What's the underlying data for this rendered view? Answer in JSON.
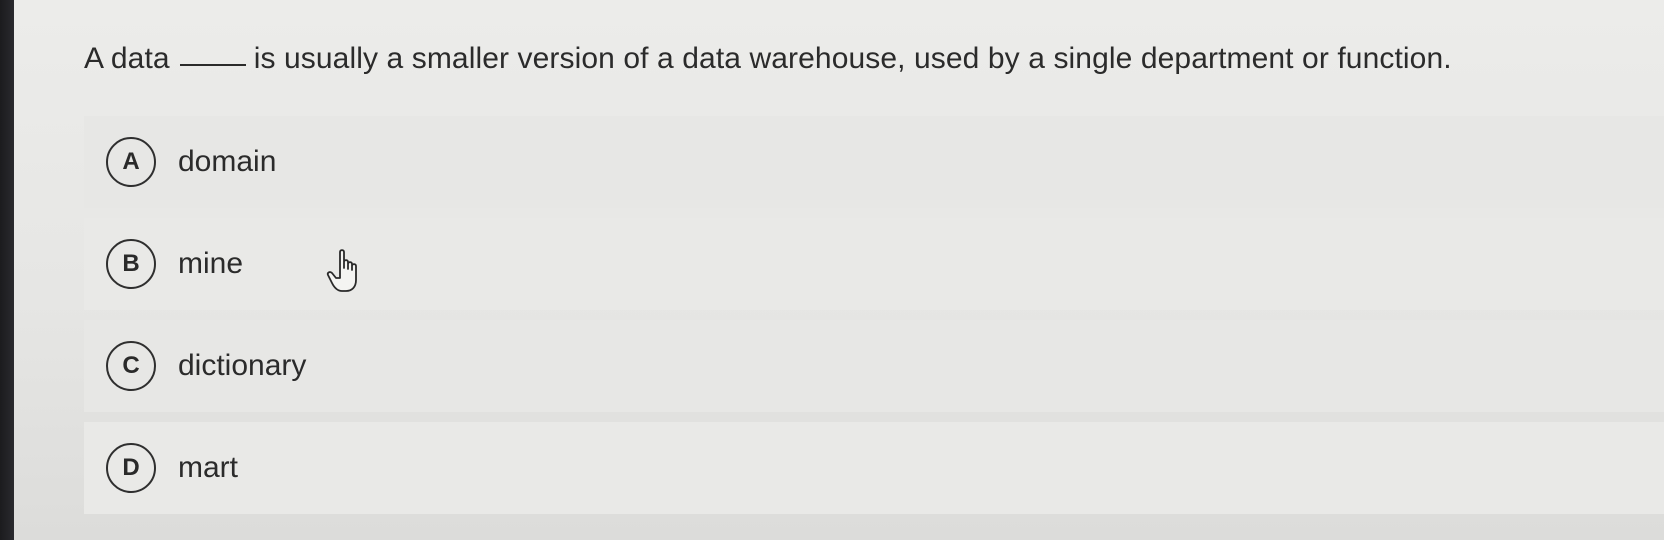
{
  "question": {
    "prefix": "A data",
    "suffix": "is usually a smaller version of a data warehouse, used by a single department or function."
  },
  "options": [
    {
      "letter": "A",
      "text": "domain"
    },
    {
      "letter": "B",
      "text": "mine"
    },
    {
      "letter": "C",
      "text": "dictionary"
    },
    {
      "letter": "D",
      "text": "mart"
    }
  ],
  "cursor": {
    "icon": "hand-pointer-icon"
  }
}
